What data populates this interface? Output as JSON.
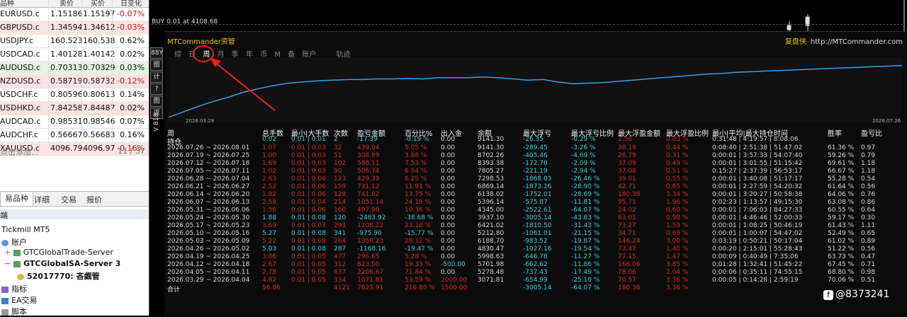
{
  "market_watch": {
    "headers": [
      "品种",
      "卖价",
      "买价",
      "日变化"
    ],
    "rows": [
      {
        "symbol": "EURUSD.c",
        "bid": "1.15186",
        "ask": "1.15197",
        "change": "-0.07%",
        "trend": "neutral"
      },
      {
        "symbol": "GBPUSD.c",
        "bid": "1.34594",
        "ask": "1.34612",
        "change": "-0.03%",
        "trend": "down"
      },
      {
        "symbol": "USDJPY.c",
        "bid": "160.523",
        "ask": "160.538",
        "change": "0.62%",
        "trend": "neutral"
      },
      {
        "symbol": "USDCAD.c",
        "bid": "1.40128",
        "ask": "1.40142",
        "change": "0.02%",
        "trend": "neutral"
      },
      {
        "symbol": "AUDUSD.c",
        "bid": "0.70313",
        "ask": "0.70329",
        "change": "0.03%",
        "trend": "up"
      },
      {
        "symbol": "NZDUSD.c",
        "bid": "0.58719",
        "ask": "0.58732",
        "change": "-0.12%",
        "trend": "down"
      },
      {
        "symbol": "USDCHF.c",
        "bid": "0.80596",
        "ask": "0.80613",
        "change": "0.14%",
        "trend": "neutral"
      },
      {
        "symbol": "USDHKD.c",
        "bid": "7.84258",
        "ask": "7.84487",
        "change": "0.02%",
        "trend": "down"
      },
      {
        "symbol": "AUDCAD.c",
        "bid": "0.98531",
        "ask": "0.98546",
        "change": "0.07%",
        "trend": "neutral"
      },
      {
        "symbol": "AUDCHF.c",
        "bid": "0.56667",
        "ask": "0.56683",
        "change": "0.16%",
        "trend": "neutral"
      },
      {
        "symbol": "XAUUSD.c",
        "bid": "4096.79",
        "ask": "4096.97",
        "change": "-0.16%",
        "trend": "down"
      }
    ],
    "add_label": "点击添加...",
    "count": "11 / 37",
    "tabs": [
      "易品种",
      "详细",
      "交易",
      "报价"
    ]
  },
  "navigator": {
    "section": "端",
    "broker": "Tickmill MT5",
    "accounts_label": "账户",
    "servers": [
      "GTCGlobalTrade-Server",
      "GTCGlobalSA-Server 3"
    ],
    "account": "52017770: 吝觑管",
    "items": [
      "指标",
      "EA交易",
      "脚本"
    ]
  },
  "chart": {
    "buy_label": "BUY 0.01 at 4108.68",
    "side_tools": [
      "88Y",
      "图",
      "计",
      "?",
      "图",
      "返"
    ],
    "vertical_label": "V 818"
  },
  "panel": {
    "title": "MTCommander资管",
    "rebrand": "复盘侠",
    "site": "http://MTCommander.com",
    "tabs": [
      "综",
      "日",
      "周",
      "月",
      "季",
      "年",
      "币",
      "M",
      "备",
      "账户"
    ],
    "active_tab": "周",
    "curve_tab": "轨迹",
    "equity_start_date": "2026.03.29",
    "equity_end_date": "2026.07.26",
    "equity_curve": [
      5,
      14,
      23,
      31,
      38,
      46,
      52,
      57,
      61,
      63,
      65,
      66,
      67,
      67,
      68,
      68,
      69,
      68,
      70,
      70,
      70,
      71,
      70,
      68,
      66,
      67,
      63,
      60,
      61,
      62,
      64,
      66,
      68,
      70,
      72,
      74,
      76,
      77,
      79,
      80,
      81,
      82,
      83,
      84,
      85,
      86,
      87,
      88,
      89,
      90
    ],
    "columns": [
      "周",
      "总手数",
      "最小|大手数",
      "次数",
      "盈亏金额",
      "百分比%",
      "出入金",
      "余额",
      "最大浮亏",
      "最大浮亏比例",
      "最大浮盈金额",
      "最大浮盈比例",
      "最小|平均|最大持仓时间",
      "胜率",
      "盈亏比"
    ],
    "holding_row": {
      "label": "持仓",
      "lots": "0.02",
      "minmax": "0.01 | 0.01",
      "count": "2",
      "pnl": "-17.39",
      "pct": "-0.19 %",
      "flow": "0.00",
      "balance": "9141.30",
      "max_dd": "-26.35",
      "max_dd_pct": "-0.29 %",
      "max_fp": "2.56",
      "max_fp_pct": "0.03 %",
      "hold": "0:31:48 | 4:19:57 | 8:08:06",
      "win": "",
      "pf": ""
    },
    "rows": [
      {
        "week": "2026.07.26 ~ 2026.08.01",
        "lots": "1.07",
        "minmax": "0.01 | 0.03",
        "count": "32",
        "pnl": "439.04",
        "pct": "5.05 %",
        "flow": "0.00",
        "balance": "9141.30",
        "max_dd": "-289.45",
        "max_dd_pct": "-3.26 %",
        "max_fp": "38.19",
        "max_fp_pct": "0.44 %",
        "hold": "0:08:40 | 2:51:38 | 51:47:02",
        "win": "61.36 %",
        "pf": "0.97"
      },
      {
        "week": "2026.07.19 ~ 2026.07.25",
        "lots": "1.00",
        "minmax": "0.01 | 0.03",
        "count": "51",
        "pnl": "308.89",
        "pct": "3.68 %",
        "flow": "0.00",
        "balance": "8702.26",
        "max_dd": "-405.46",
        "max_dd_pct": "-4.69 %",
        "max_fp": "26.79",
        "max_fp_pct": "0.31 %",
        "hold": "0:00:01 | 3:57:33 | 54:07:40",
        "win": "59.26 %",
        "pf": "0.79"
      },
      {
        "week": "2026.07.12 ~ 2026.07.18",
        "lots": "1.69",
        "minmax": "0.01 | 0.03",
        "count": "102",
        "pnl": "588.11",
        "pct": "7.53 %",
        "flow": "0.00",
        "balance": "8393.38",
        "max_dd": "-172.70",
        "max_dd_pct": "-2.09 %",
        "max_fp": "37.09",
        "max_fp_pct": "0.49 %",
        "hold": "0:00:01 | 3:01:55 | 51:15:42",
        "win": "69.61 %",
        "pf": "1.18"
      },
      {
        "week": "2026.07.05 ~ 2026.07.11",
        "lots": "1.02",
        "minmax": "0.01 | 0.03",
        "count": "90",
        "pnl": "506.74",
        "pct": "6.94 %",
        "flow": "0.00",
        "balance": "7805.27",
        "max_dd": "-221.19",
        "max_dd_pct": "-2.94 %",
        "max_fp": "37.08",
        "max_fp_pct": "0.51 %",
        "hold": "0:15:27 | 2:37:39 | 56:53:17",
        "win": "66.67 %",
        "pf": "1.18"
      },
      {
        "week": "2026.06.28 ~ 2026.07.04",
        "lots": "2.63",
        "minmax": "0.01 | 0.06",
        "count": "123",
        "pnl": "429.39",
        "pct": "6.25 %",
        "flow": "0.00",
        "balance": "7298.53",
        "max_dd": "-1868.03",
        "max_dd_pct": "-26.46 %",
        "max_fp": "39.01",
        "max_fp_pct": "0.55 %",
        "hold": "0:00:01 | 3:40:08 | 51:17:17",
        "win": "55.28 %",
        "pf": "0.54"
      },
      {
        "week": "2026.06.21 ~ 2026.06.27",
        "lots": "2.52",
        "minmax": "0.01 | 0.06",
        "count": "159",
        "pnl": "731.12",
        "pct": "11.91 %",
        "flow": "0.00",
        "balance": "6869.14",
        "max_dd": "-1873.16",
        "max_dd_pct": "-28.90 %",
        "max_fp": "42.71",
        "max_fp_pct": "0.65 %",
        "hold": "0:00:01 | 2:27:59 | 54:20:32",
        "win": "61.64 %",
        "pf": "0.56"
      },
      {
        "week": "2026.06.14 ~ 2026.06.20",
        "lots": "1.82",
        "minmax": "0.01 | 0.06",
        "count": "128",
        "pnl": "741.82",
        "pct": "13.75 %",
        "flow": "0.00",
        "balance": "6138.02",
        "max_dd": "-1752.01",
        "max_dd_pct": "-28.69 %",
        "max_fp": "180.38",
        "max_fp_pct": "3.34 %",
        "hold": "0:00:01 | 3:20:27 | 50:58:38",
        "win": "64.06 %",
        "pf": "0.76"
      },
      {
        "week": "2026.06.07 ~ 2026.06.13",
        "lots": "2.58",
        "minmax": "0.01 | 0.04",
        "count": "214",
        "pnl": "1051.14",
        "pct": "24.19 %",
        "flow": "0.00",
        "balance": "5396.14",
        "max_dd": "-575.87",
        "max_dd_pct": "-11.81 %",
        "max_fp": "95.71",
        "max_fp_pct": "1.96 %",
        "hold": "0:02:23 | 1:13:57 | 49:15:30",
        "win": "63.08 %",
        "pf": "0.86"
      },
      {
        "week": "2026.05.31 ~ 2026.06.06",
        "lots": "1.56",
        "minmax": "0.01 | 0.06",
        "count": "160",
        "pnl": "407.90",
        "pct": "10.36 %",
        "flow": "0.00",
        "balance": "4345.00",
        "max_dd": "-2522.61",
        "max_dd_pct": "-64.07 %",
        "max_fp": "24.02",
        "max_fp_pct": "0.60 %",
        "hold": "0:00:01 | 7:06:03 | 84:27:33",
        "win": "60.55 %",
        "pf": "0.64"
      },
      {
        "week": "2026.05.24 ~ 2026.05.30",
        "lots": "1.88",
        "minmax": "0.01 | 0.08",
        "count": "120",
        "pnl": "-2483.92",
        "pct": "-38.68 %",
        "flow": "0.00",
        "balance": "3937.10",
        "max_dd": "-3005.14",
        "max_dd_pct": "-43.83 %",
        "max_fp": "63.01",
        "max_fp_pct": "0.98 %",
        "hold": "0:00:01 | 4:46:46 | 52:00:33",
        "win": "59.17 %",
        "pf": "0.30"
      },
      {
        "week": "2026.05.17 ~ 2026.05.23",
        "lots": "3.69",
        "minmax": "0.01 | 0.03",
        "count": "293",
        "pnl": "1208.22",
        "pct": "23.18 %",
        "flow": "0.00",
        "balance": "6421.02",
        "max_dd": "-1810.50",
        "max_dd_pct": "-31.43 %",
        "max_fp": "73.27",
        "max_fp_pct": "1.59 %",
        "hold": "0:00:01 | 1:08:25 | 50:46:19",
        "win": "61.43 %",
        "pf": "1.11"
      },
      {
        "week": "2026.05.10 ~ 2026.05.16",
        "lots": "5.27",
        "minmax": "0.01 | 0.08",
        "count": "341",
        "pnl": "-975.90",
        "pct": "-15.77 %",
        "flow": "0.00",
        "balance": "5212.80",
        "max_dd": "-1061.01",
        "max_dd_pct": "-21.15 %",
        "max_fp": "34.71",
        "max_fp_pct": "0.69 %",
        "hold": "0:00:01 | 1:00:07 | 54:47:02",
        "win": "52.49 %",
        "pf": "0.65"
      },
      {
        "week": "2026.05.03 ~ 2026.05.09",
        "lots": "5.22",
        "minmax": "0.01 | 0.08",
        "count": "264",
        "pnl": "1358.23",
        "pct": "28.12 %",
        "flow": "0.00",
        "balance": "6188.70",
        "max_dd": "-983.52",
        "max_dd_pct": "-19.87 %",
        "max_fp": "146.24",
        "max_fp_pct": "3.00 %",
        "hold": "0:03:19 | 0:50:21 | 50:17:04",
        "win": "61.02 %",
        "pf": "0.89"
      },
      {
        "week": "2026.04.26 ~ 2026.05.02",
        "lots": "5.03",
        "minmax": "0.01 | 0.08",
        "count": "287",
        "pnl": "-1168.16",
        "pct": "-19.47 %",
        "flow": "0.00",
        "balance": "4830.47",
        "max_dd": "-1027.16",
        "max_dd_pct": "-19.54 %",
        "max_fp": "73.47",
        "max_fp_pct": "1.40 %",
        "hold": "0:00:20 | 2:15:01 | 55:28:43",
        "win": "51.22 %",
        "pf": "0.56"
      },
      {
        "week": "2026.04.19 ~ 2026.04.25",
        "lots": "3.06",
        "minmax": "0.01 | 0.05",
        "count": "477",
        "pnl": "296.65",
        "pct": "5.28 %",
        "flow": "0.00",
        "balance": "5998.63",
        "max_dd": "-646.78",
        "max_dd_pct": "-11.27 %",
        "max_fp": "77.15",
        "max_fp_pct": "1.47 %",
        "hold": "0:00:09 | 0:40:49 | 7:35:06",
        "win": "63.73 %",
        "pf": "0.47"
      },
      {
        "week": "2026.04.12 ~ 2026.04.18",
        "lots": "2.67",
        "minmax": "0.01 | 0.05",
        "count": "312",
        "pnl": "823.50",
        "pct": "19.33 %",
        "flow": "-500.00",
        "balance": "5701.98",
        "max_dd": "-662.62",
        "max_dd_pct": "-11.86 %",
        "max_fp": "166.06",
        "max_fp_pct": "3.85 %",
        "hold": "0:01:28 | 1:32:41 | 51:45:22",
        "win": "67.45 %",
        "pf": "0.71"
      },
      {
        "week": "2026.04.05 ~ 2026.04.11",
        "lots": "2.78",
        "minmax": "0.01 | 0.05",
        "count": "637",
        "pnl": "2206.67",
        "pct": "71.84 %",
        "flow": "0.00",
        "balance": "5278.48",
        "max_dd": "-737.43",
        "max_dd_pct": "-17.49 %",
        "max_fp": "78.06",
        "max_fp_pct": "2.04 %",
        "hold": "0:00:06 | 0:35:11 | 74:55:15",
        "win": "68.80 %",
        "pf": "0.98"
      },
      {
        "week": "2026.03.29 ~ 2026.04.04",
        "lots": "4.82",
        "minmax": "0.01 | 0.05",
        "count": "334",
        "pnl": "1071.81",
        "pct": "53.59 %",
        "flow": "2000.00",
        "balance": "3071.81",
        "max_dd": "-654.99",
        "max_dd_pct": "-25.10 %",
        "max_fp": "70.57",
        "max_fp_pct": "3.36 %",
        "hold": "0:00:05 | 0:14:28 | 2:59:19",
        "win": "70.06 %",
        "pf": "0.51"
      }
    ],
    "total_row": {
      "label": "合计",
      "lots": "56.86",
      "count": "4121",
      "pnl": "7623.91",
      "pct": "216.80 %",
      "flow": "1500.00",
      "max_dd": "-3005.14",
      "max_dd_pct": "-64.07 %",
      "max_fp": "180.38",
      "max_fp_pct": "3.36 %"
    }
  },
  "watermark": {
    "handle": "@8373241",
    "icon": "f"
  },
  "colors": {
    "red": "#d12a2a",
    "cyan": "#3bd0d4",
    "accent": "#e6c200",
    "curve": "#3a9fe0",
    "arrow": "#e51d1d"
  }
}
